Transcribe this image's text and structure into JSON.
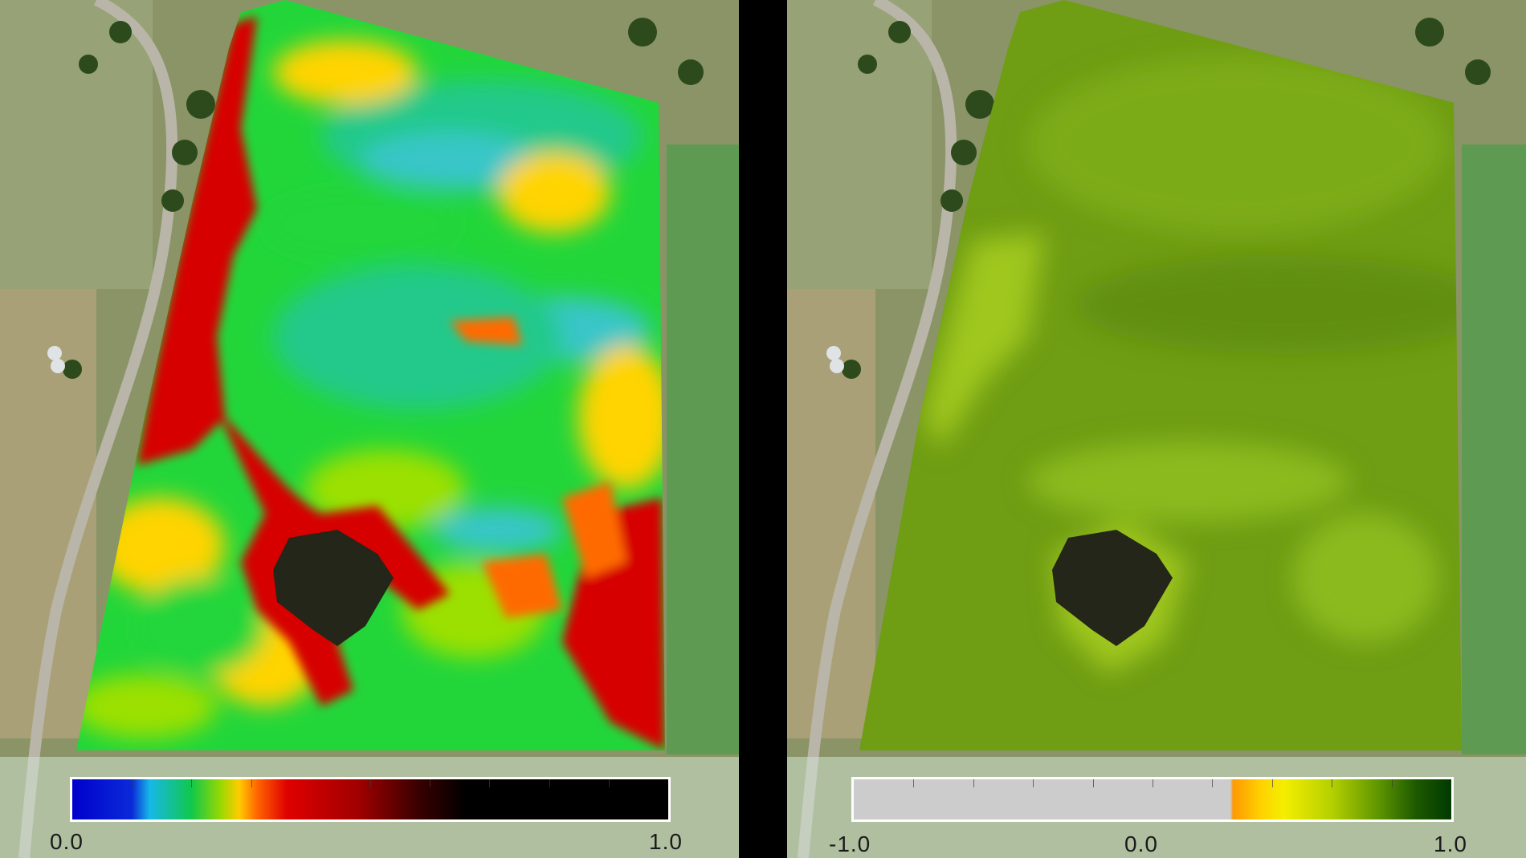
{
  "maps": [
    {
      "id": "left",
      "layer_palette": [
        "#d60000",
        "#ff6a00",
        "#ffd400",
        "#9be000",
        "#22d63a",
        "#20c98a",
        "#38c6c8"
      ],
      "colorbar": {
        "min_label": "0.0",
        "max_label": "1.0",
        "gradient_stops": [
          {
            "offset": 0.0,
            "color": "#0000cc"
          },
          {
            "offset": 0.1,
            "color": "#0a2ad8"
          },
          {
            "offset": 0.13,
            "color": "#16b8e8"
          },
          {
            "offset": 0.2,
            "color": "#10c84a"
          },
          {
            "offset": 0.25,
            "color": "#9cd800"
          },
          {
            "offset": 0.28,
            "color": "#ffcc00"
          },
          {
            "offset": 0.31,
            "color": "#ff6600"
          },
          {
            "offset": 0.36,
            "color": "#e00000"
          },
          {
            "offset": 0.48,
            "color": "#a00000"
          },
          {
            "offset": 0.58,
            "color": "#3a0000"
          },
          {
            "offset": 0.66,
            "color": "#000000"
          },
          {
            "offset": 1.0,
            "color": "#000000"
          }
        ]
      }
    },
    {
      "id": "right",
      "layer_palette": [
        "#6f9d14",
        "#7fae18",
        "#8fbf1e",
        "#a8cf20",
        "#5f8c10"
      ],
      "colorbar": {
        "min_label": "-1.0",
        "mid_label": "0.0",
        "max_label": "1.0",
        "gradient_stops": [
          {
            "offset": 0.0,
            "color": "#cccccc"
          },
          {
            "offset": 0.63,
            "color": "#cccccc"
          },
          {
            "offset": 0.635,
            "color": "#ff9900"
          },
          {
            "offset": 0.68,
            "color": "#ffd000"
          },
          {
            "offset": 0.72,
            "color": "#f4ee00"
          },
          {
            "offset": 0.8,
            "color": "#b4d000"
          },
          {
            "offset": 0.88,
            "color": "#5c9400"
          },
          {
            "offset": 0.94,
            "color": "#1e5a00"
          },
          {
            "offset": 1.0,
            "color": "#003a00"
          }
        ]
      }
    }
  ]
}
